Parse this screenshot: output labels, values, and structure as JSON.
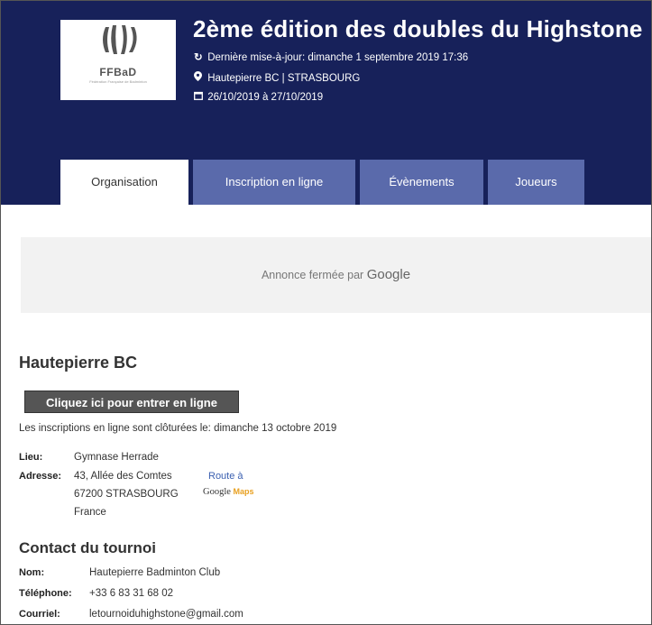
{
  "header": {
    "logo_text": "FFBaD",
    "logo_subtitle": "Fédération Française de Badminton",
    "title": "2ème édition des doubles du Highstone",
    "last_update": "Dernière mise-à-jour: dimanche 1 septembre 2019 17:36",
    "location": "Hautepierre BC | STRASBOURG",
    "dates": "26/10/2019 à 27/10/2019"
  },
  "tabs": [
    {
      "label": "Organisation",
      "active": true
    },
    {
      "label": "Inscription en ligne",
      "active": false
    },
    {
      "label": "Évènements",
      "active": false
    },
    {
      "label": "Joueurs",
      "active": false
    }
  ],
  "ad": {
    "text": "Annonce fermée par",
    "brand": "Google"
  },
  "club": {
    "name": "Hautepierre BC",
    "enter_button": "Cliquez ici pour entrer en ligne",
    "closed_notice": "Les inscriptions en ligne sont clôturées le: dimanche 13 octobre 2019",
    "lieu_label": "Lieu:",
    "lieu_value": "Gymnase Herrade",
    "adresse_label": "Adresse:",
    "address_line1": "43, Allée des Comtes",
    "address_line2": "67200 STRASBOURG",
    "address_line3": "France",
    "route_link": "Route à",
    "gmaps_google": "Google",
    "gmaps_maps": "Maps"
  },
  "contact": {
    "heading": "Contact du tournoi",
    "nom_label": "Nom:",
    "nom_value": "Hautepierre Badminton Club",
    "tel_label": "Téléphone:",
    "tel_value": "+33 6 83 31 68 02",
    "email_label": "Courriel:",
    "email_value": "letournoiduhighstone@gmail.com"
  },
  "colors": {
    "header_bg": "#17215a",
    "tab_inactive": "#5a6aab",
    "link": "#3a5fb0"
  }
}
